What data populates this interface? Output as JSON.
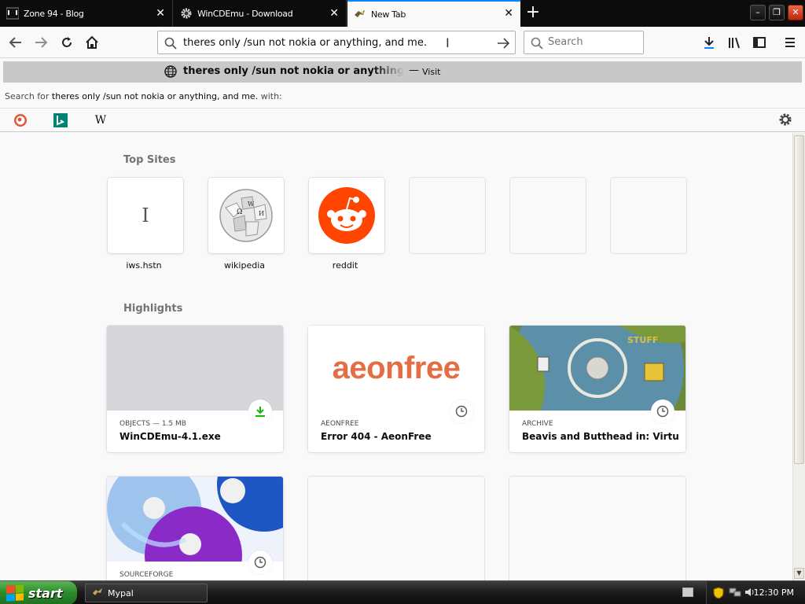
{
  "tabs": [
    {
      "title": "Zone 94 - Blog",
      "favicon": "zone94-icon"
    },
    {
      "title": "WinCDEmu - Download",
      "favicon": "gear-icon"
    },
    {
      "title": "New Tab",
      "favicon": "newtab-icon"
    }
  ],
  "urlbar": {
    "value": "theres only /sun not nokia or anything, and me."
  },
  "search": {
    "placeholder": "Search"
  },
  "dropdown": {
    "suggestion_text": "theres only /sun not nokia or anything, and me.",
    "dash": "—",
    "visit_label": "Visit",
    "search_for_prefix": "Search for",
    "search_for_query": "theres only /sun not nokia or anything, and me.",
    "search_for_suffix": "with:",
    "engines": [
      "duckduckgo-icon",
      "bing-icon",
      "wikipedia-icon"
    ]
  },
  "topsites": {
    "title": "Top Sites",
    "items": [
      {
        "label": "iws.hstn"
      },
      {
        "label": "wikipedia"
      },
      {
        "label": "reddit"
      },
      {
        "label": ""
      },
      {
        "label": ""
      },
      {
        "label": ""
      }
    ]
  },
  "highlights": {
    "title": "Highlights",
    "items": [
      {
        "meta": "OBJECTS — 1.5 MB",
        "title": "WinCDEmu-4.1.exe",
        "badge": "download-icon"
      },
      {
        "meta": "AEONFREE",
        "title": "Error 404 - AeonFree",
        "image_text": "aeonfree",
        "badge": "clock-icon"
      },
      {
        "meta": "ARCHIVE",
        "title": "Beavis and Butthead in: Virtual S...",
        "badge": "clock-icon"
      },
      {
        "meta": "SOURCEFORGE",
        "title": "",
        "badge": "clock-icon"
      }
    ]
  },
  "taskbar": {
    "start_label": "start",
    "task_label": "Mypal",
    "clock": "12:30 PM"
  },
  "colors": {
    "accent": "#0a84ff",
    "download_green": "#12bc00",
    "reddit": "#ff4500",
    "aeonfree": "#e36e45"
  }
}
